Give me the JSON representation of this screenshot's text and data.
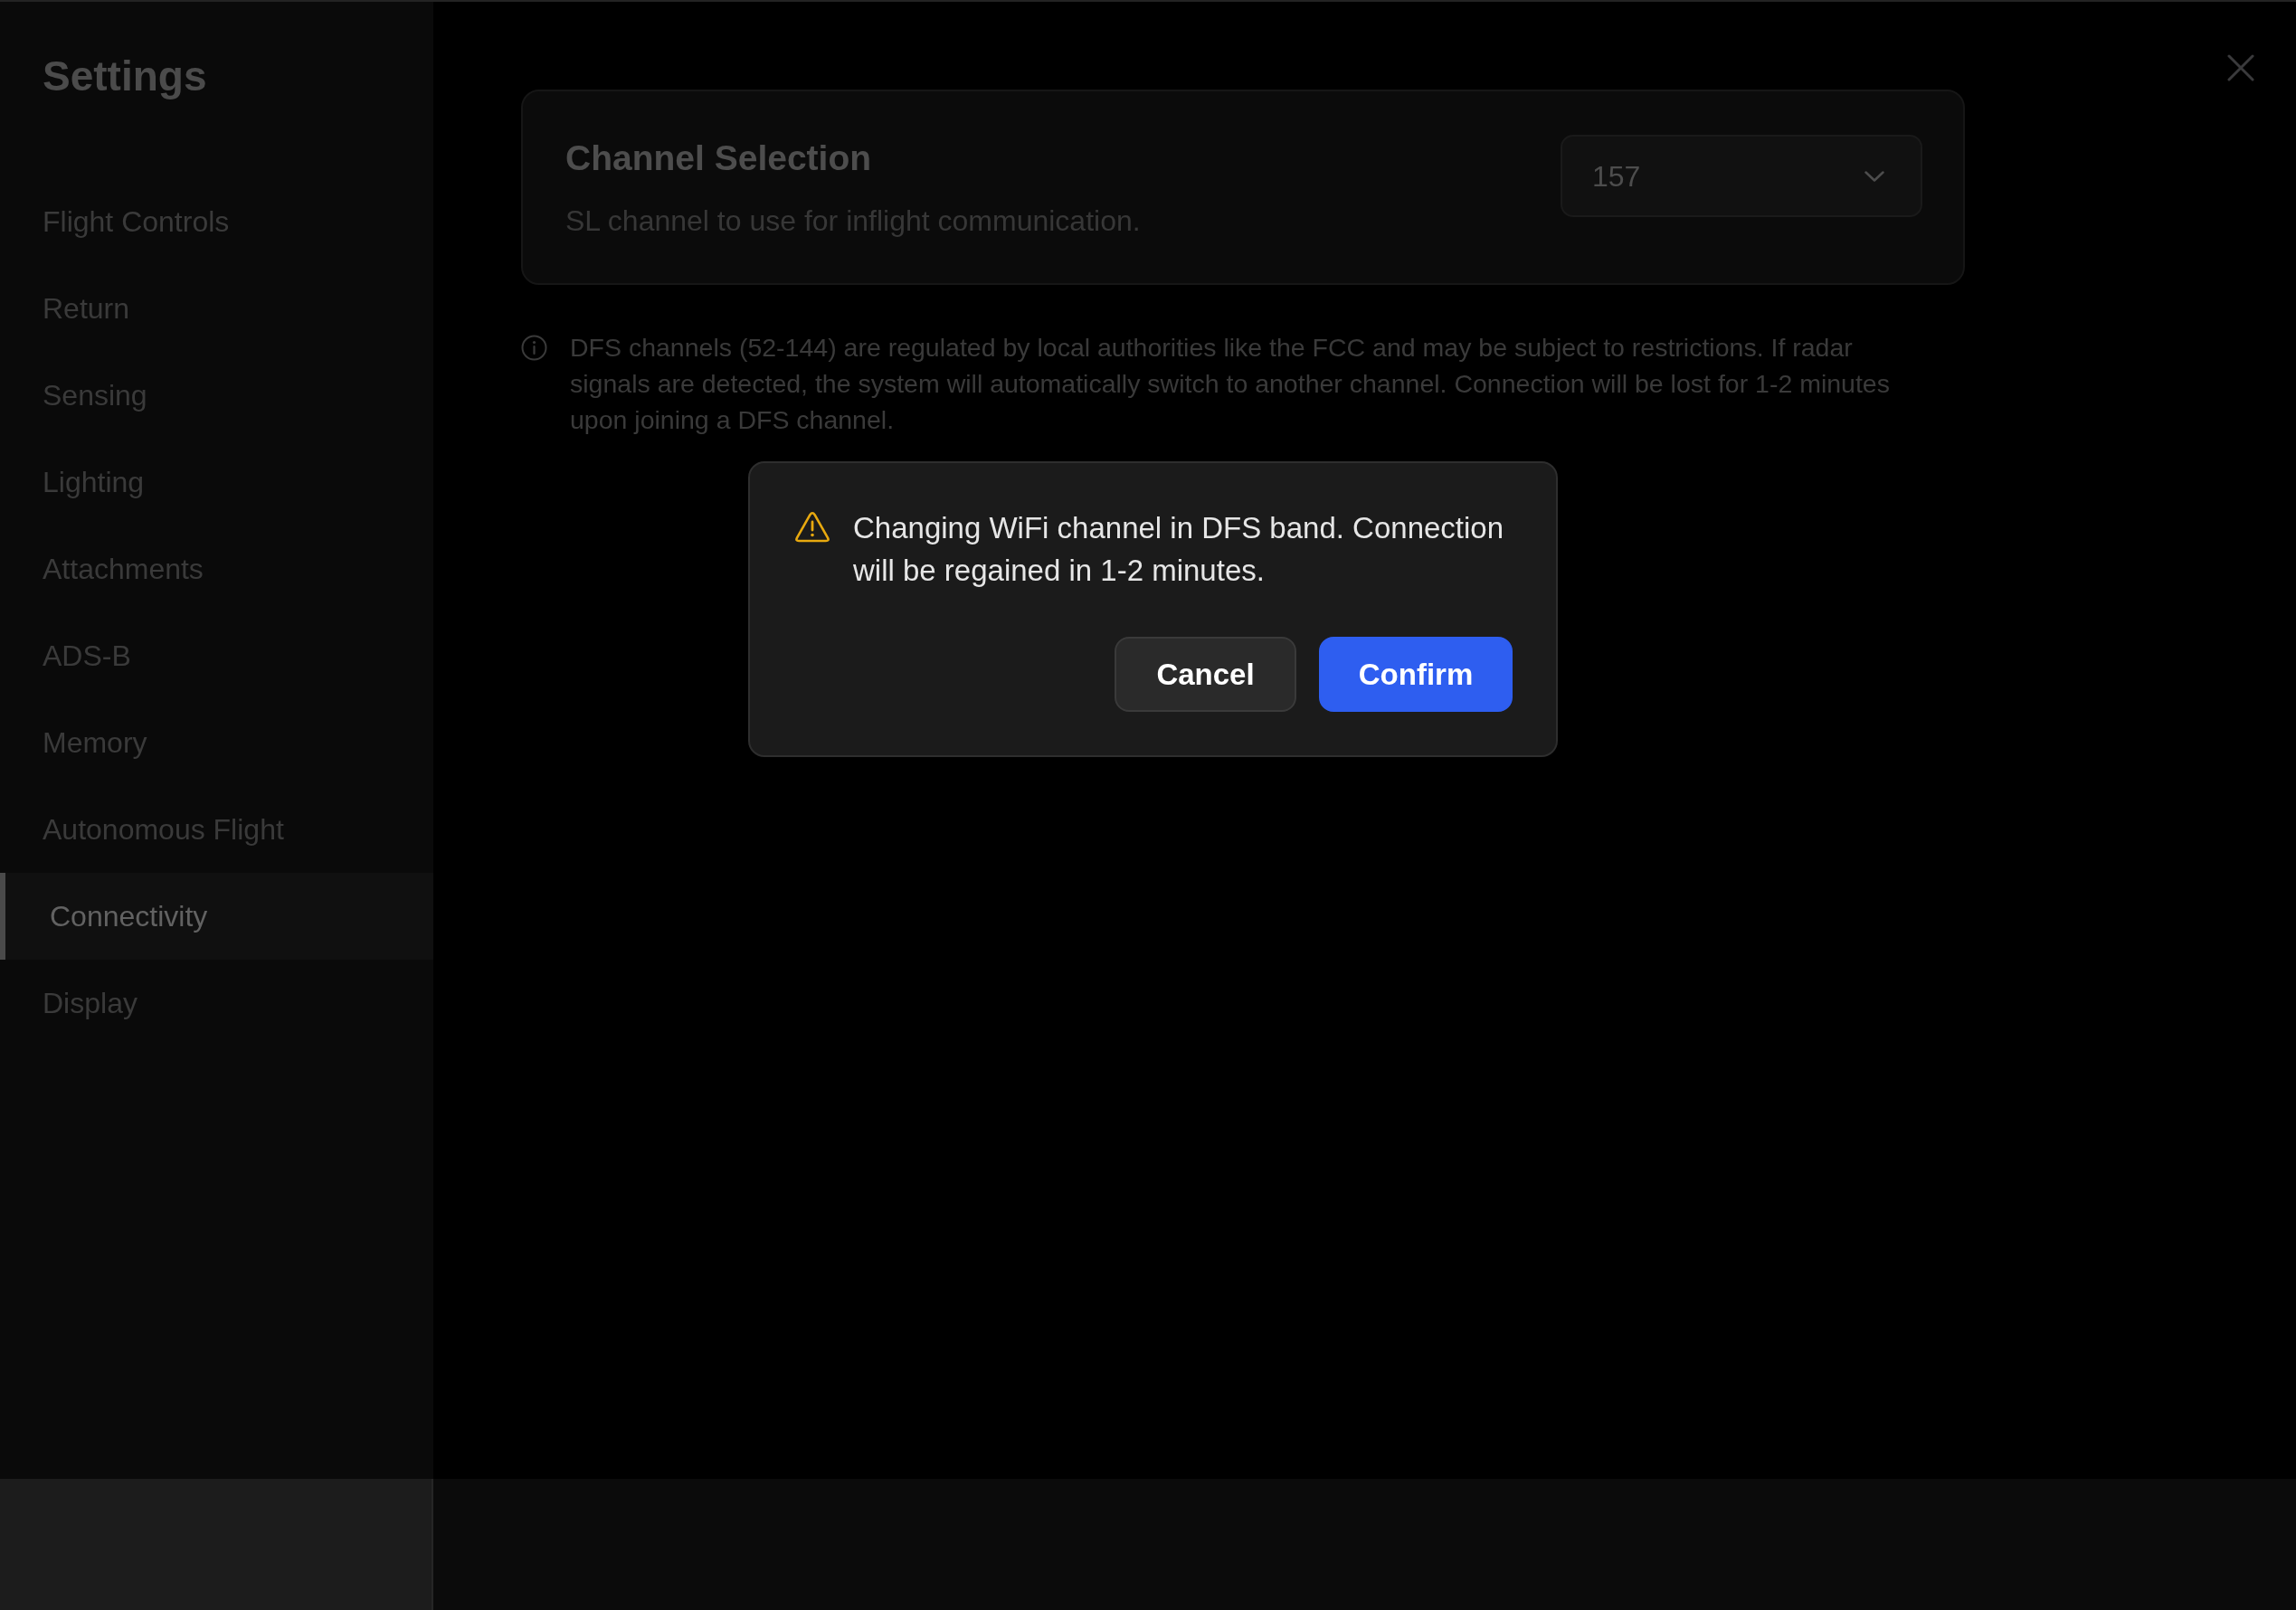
{
  "sidebar": {
    "title": "Settings",
    "items": [
      {
        "label": "Flight Controls",
        "selected": false
      },
      {
        "label": "Return",
        "selected": false
      },
      {
        "label": "Sensing",
        "selected": false
      },
      {
        "label": "Lighting",
        "selected": false
      },
      {
        "label": "Attachments",
        "selected": false
      },
      {
        "label": "ADS-B",
        "selected": false
      },
      {
        "label": "Memory",
        "selected": false
      },
      {
        "label": "Autonomous Flight",
        "selected": false
      },
      {
        "label": "Connectivity",
        "selected": true
      },
      {
        "label": "Display",
        "selected": false
      }
    ]
  },
  "channel_selection": {
    "title": "Channel Selection",
    "description": "SL channel to use for inflight communication.",
    "channel_select": {
      "value": "157"
    }
  },
  "info_note": {
    "text": "DFS channels (52-144) are regulated by local authorities like the FCC and may be subject to restrictions. If radar signals are detected, the system will automatically switch to another channel. Connection will be lost for 1-2 minutes upon joining a DFS channel."
  },
  "dialog": {
    "message": "Changing WiFi channel in DFS band. Connection will be regained in 1-2 minutes.",
    "buttons": [
      {
        "label": "Cancel",
        "kind": "secondary"
      },
      {
        "label": "Confirm",
        "kind": "primary"
      }
    ]
  }
}
